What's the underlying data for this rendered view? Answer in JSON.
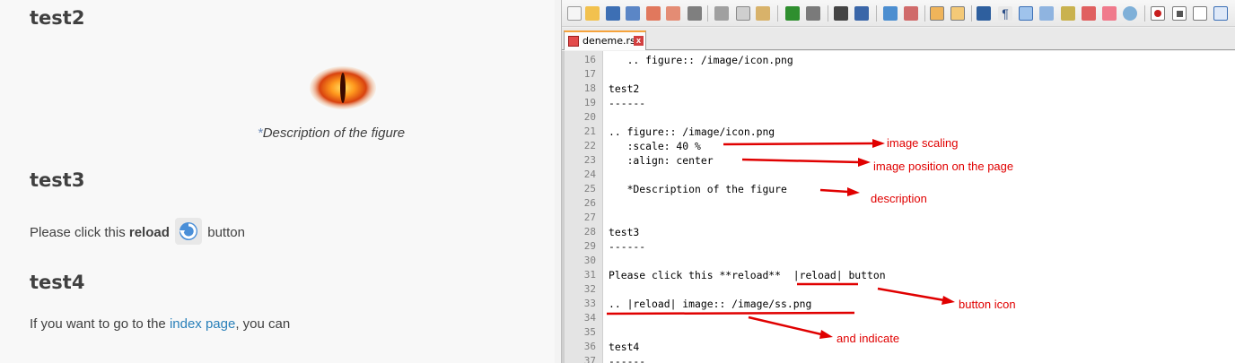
{
  "doc": {
    "test2_heading": "test2",
    "figure_caption_star": "*",
    "figure_caption": "Description of the figure",
    "test3_heading": "test3",
    "reload_prefix": "Please click this ",
    "reload_bold": "reload",
    "reload_suffix": "button",
    "test4_heading": "test4",
    "test4_prefix": "If you want to go to the ",
    "test4_link": "index page",
    "test4_suffix": ", you can",
    "truncated_line": "... ......... ...... .. ...... ....... ......."
  },
  "editor": {
    "tab_name": "deneme.rst",
    "tab_close": "x",
    "lines": [
      {
        "num": "16",
        "text": "   .. figure:: /image/icon.png"
      },
      {
        "num": "17",
        "text": ""
      },
      {
        "num": "18",
        "text": "test2"
      },
      {
        "num": "19",
        "text": "------"
      },
      {
        "num": "20",
        "text": ""
      },
      {
        "num": "21",
        "text": ".. figure:: /image/icon.png"
      },
      {
        "num": "22",
        "text": "   :scale: 40 %"
      },
      {
        "num": "23",
        "text": "   :align: center"
      },
      {
        "num": "24",
        "text": ""
      },
      {
        "num": "25",
        "text": "   *Description of the figure"
      },
      {
        "num": "26",
        "text": ""
      },
      {
        "num": "27",
        "text": ""
      },
      {
        "num": "28",
        "text": "test3"
      },
      {
        "num": "29",
        "text": "------"
      },
      {
        "num": "30",
        "text": ""
      },
      {
        "num": "31",
        "text": "Please click this **reload**  |reload| button"
      },
      {
        "num": "32",
        "text": ""
      },
      {
        "num": "33",
        "text": ".. |reload| image:: /image/ss.png"
      },
      {
        "num": "34",
        "text": ""
      },
      {
        "num": "35",
        "text": ""
      },
      {
        "num": "36",
        "text": "test4"
      },
      {
        "num": "37",
        "text": "------"
      }
    ]
  },
  "annotations": {
    "image_scaling": "image scaling",
    "image_position": "image position on the page",
    "description": "description",
    "button_icon": "button icon",
    "and_indicate": "and indicate"
  },
  "colors": {
    "annotation": "#e00000",
    "link": "#2980b9",
    "heading": "#404040"
  }
}
